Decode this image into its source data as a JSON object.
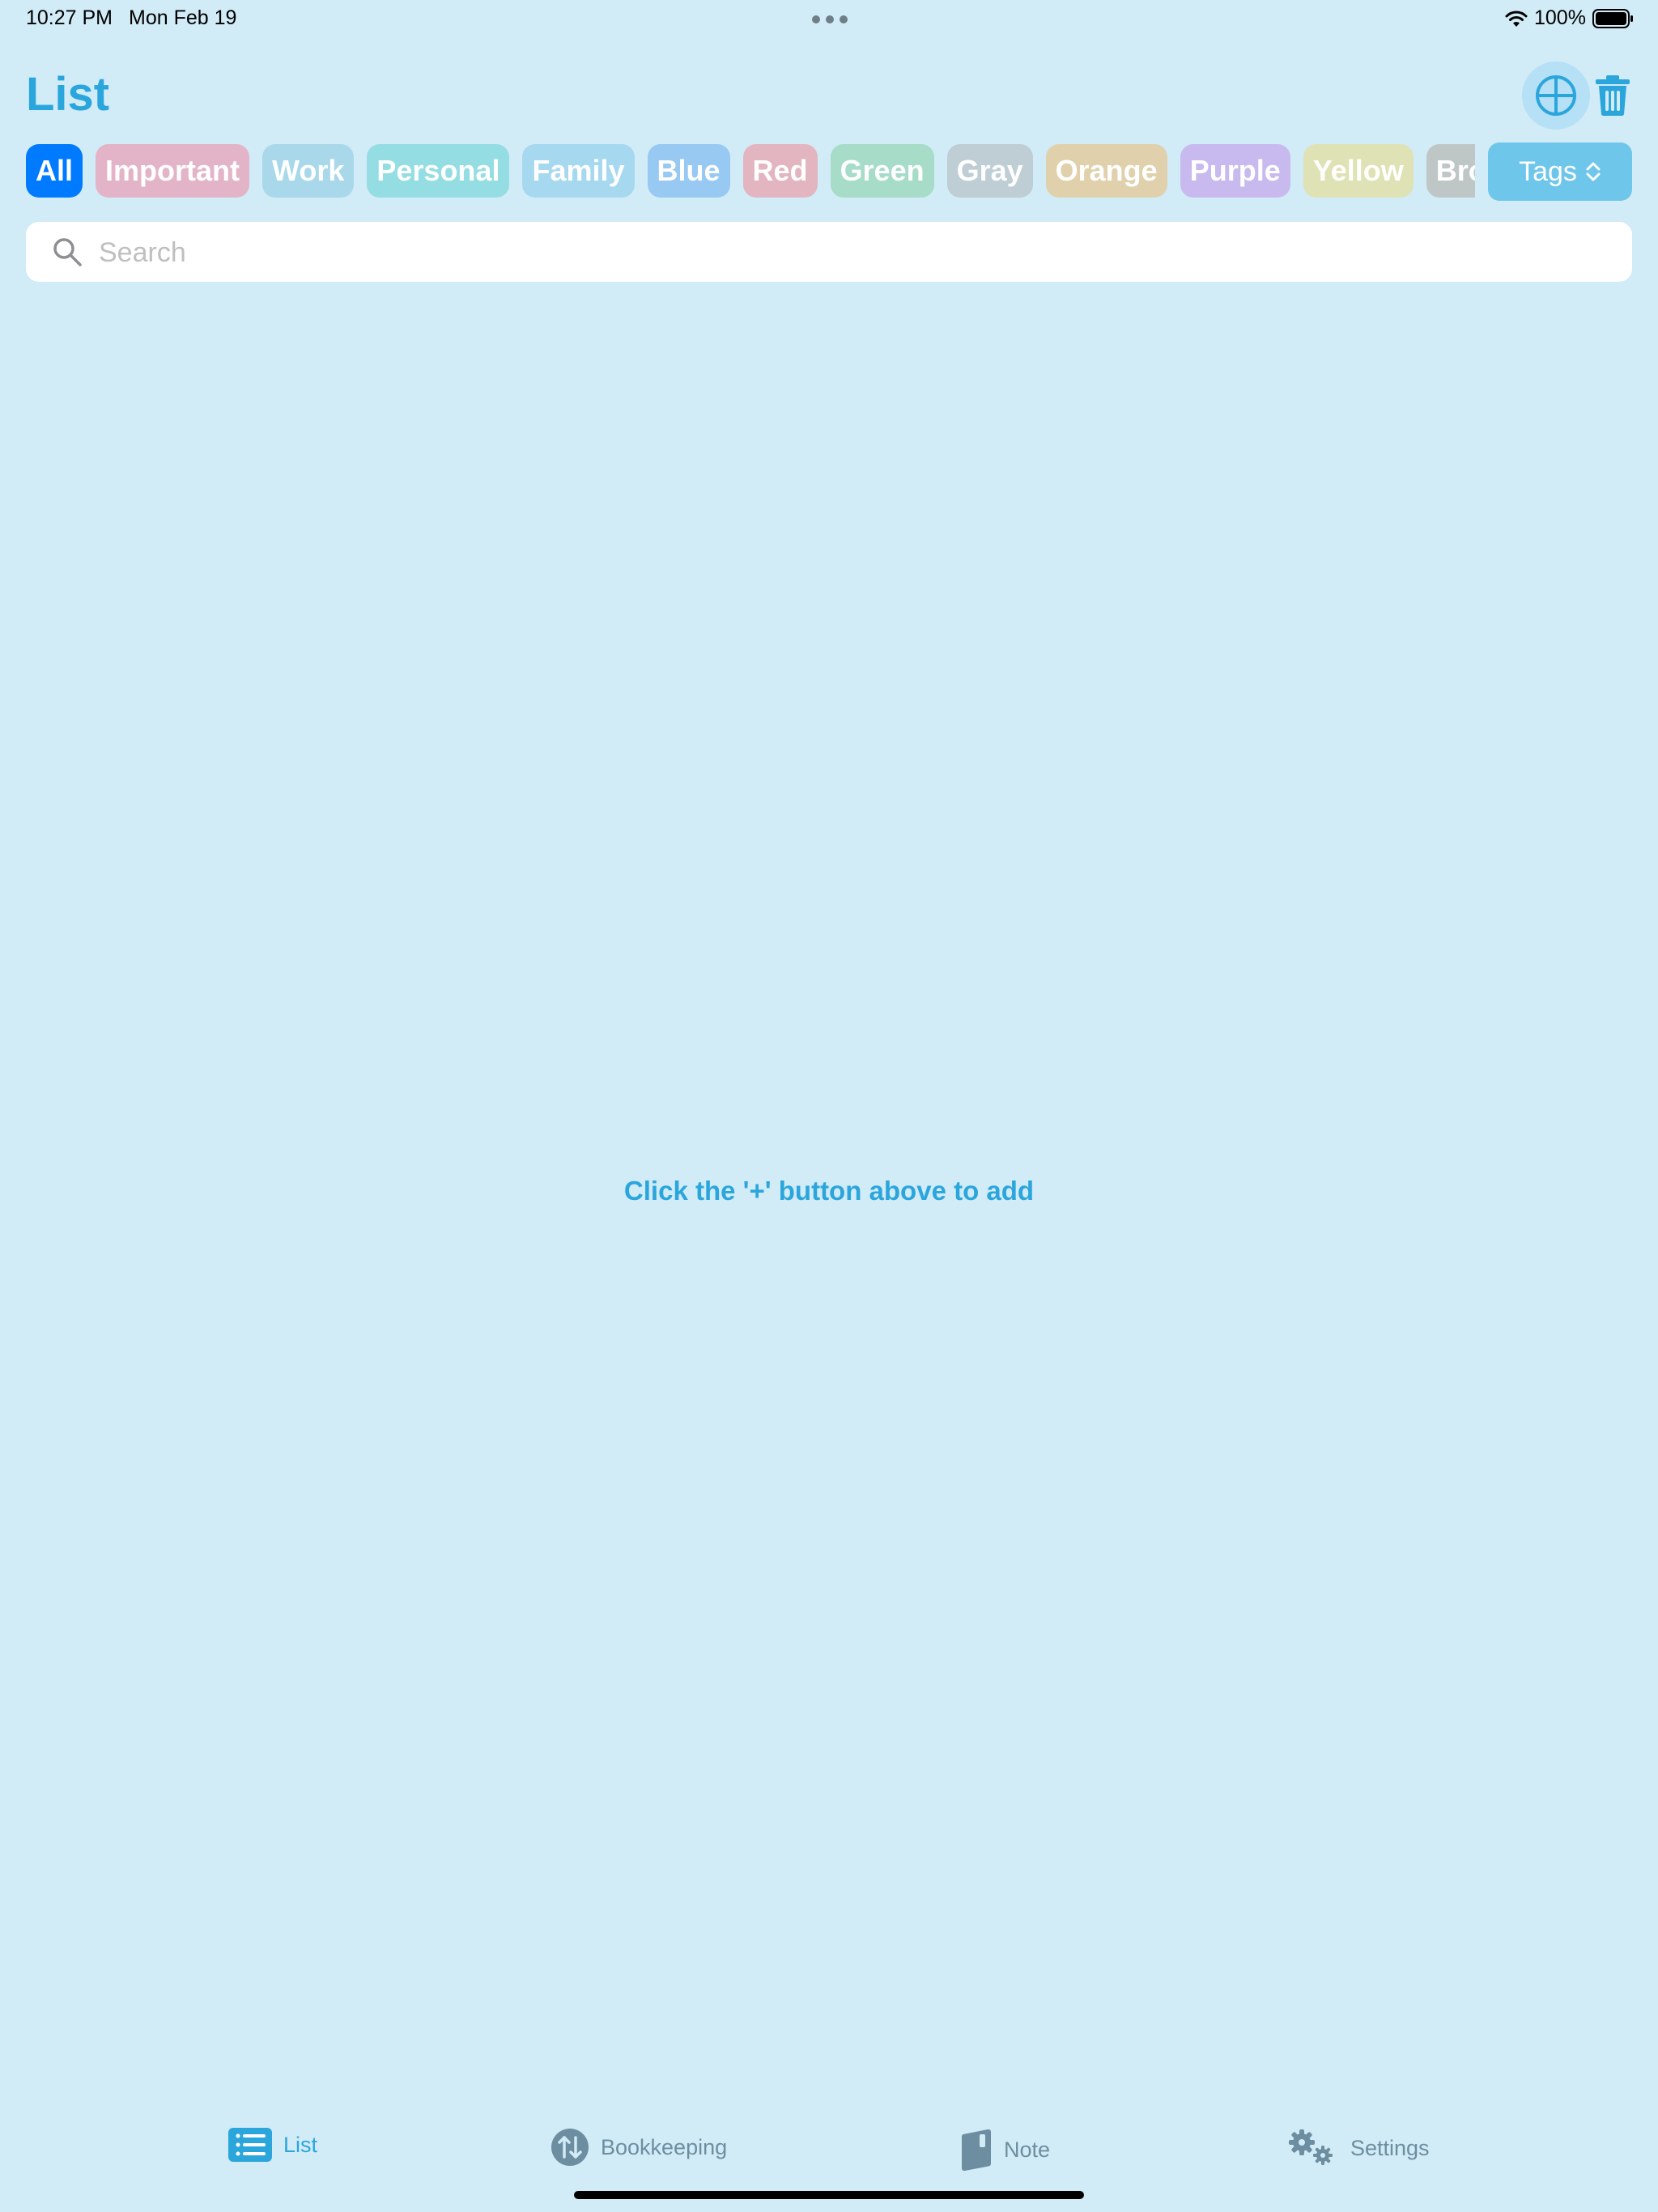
{
  "status_bar": {
    "time": "10:27 PM",
    "date": "Mon Feb 19",
    "battery": "100%"
  },
  "header": {
    "title": "List"
  },
  "tags": [
    {
      "label": "All",
      "color": "#007aff"
    },
    {
      "label": "Important",
      "color": "#e3b4c8"
    },
    {
      "label": "Work",
      "color": "#a9d8ea"
    },
    {
      "label": "Personal",
      "color": "#94dde3"
    },
    {
      "label": "Family",
      "color": "#a6d9f0"
    },
    {
      "label": "Blue",
      "color": "#97c9f3"
    },
    {
      "label": "Red",
      "color": "#e2b5c0"
    },
    {
      "label": "Green",
      "color": "#a6dcc8"
    },
    {
      "label": "Gray",
      "color": "#bfcdd4"
    },
    {
      "label": "Orange",
      "color": "#e0d1ac"
    },
    {
      "label": "Purple",
      "color": "#c8baee"
    },
    {
      "label": "Yellow",
      "color": "#dfe2b4"
    },
    {
      "label": "Bro",
      "color": "#bfc7c6"
    }
  ],
  "tags_button": {
    "label": "Tags"
  },
  "search": {
    "placeholder": "Search",
    "value": ""
  },
  "empty_state": {
    "message": "Click the '+' button above to add"
  },
  "tab_bar": {
    "items": [
      {
        "label": "List",
        "icon": "list-icon",
        "active": true
      },
      {
        "label": "Bookkeeping",
        "icon": "bookkeeping-icon",
        "active": false
      },
      {
        "label": "Note",
        "icon": "note-icon",
        "active": false
      },
      {
        "label": "Settings",
        "icon": "gear-icon",
        "active": false
      }
    ]
  },
  "colors": {
    "accent": "#2ba6dc",
    "background": "#d1ebf7",
    "tab_inactive": "#6d8ea0"
  }
}
